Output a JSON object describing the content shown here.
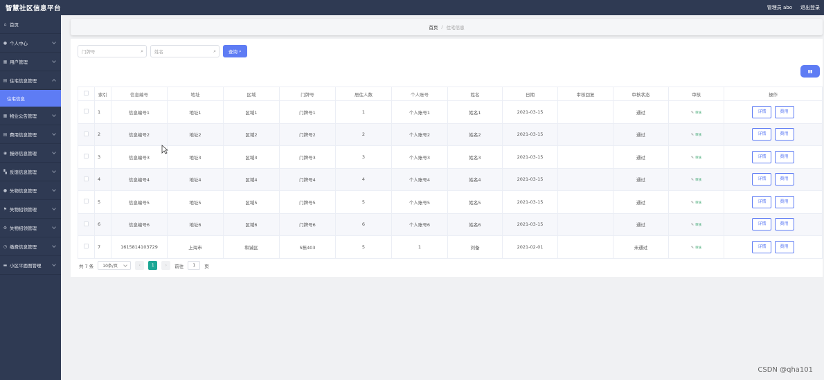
{
  "app": {
    "title": "智慧社区信息平台",
    "admin": "管理员 abo",
    "logout": "退出登录"
  },
  "sidebar": {
    "home": "首页",
    "personal": "个人中心",
    "users": "用户管理",
    "housing": "住宅信息管理",
    "housing_sub": "住宅信息",
    "items": [
      {
        "label": "物业公告管理",
        "icon": "grid-icon"
      },
      {
        "label": "費用信息管理",
        "icon": "doc-icon"
      },
      {
        "label": "报修信息管理",
        "icon": "circle-icon"
      },
      {
        "label": "反馈信息管理",
        "icon": "apps-icon"
      },
      {
        "label": "失物信息管理",
        "icon": "user-icon"
      },
      {
        "label": "失物招领管理",
        "icon": "flag-icon"
      },
      {
        "label": "失物招领管理",
        "icon": "gear-icon"
      },
      {
        "label": "缴费信息管理",
        "icon": "clock-icon"
      },
      {
        "label": "小区平面图管理",
        "icon": "chat-icon"
      }
    ]
  },
  "breadcrumb": {
    "home": "首页",
    "sep": "/",
    "current": "住宅信息"
  },
  "search": {
    "door_placeholder": "门牌号",
    "name_placeholder": "姓名",
    "query_label": "查询"
  },
  "table": {
    "headers": [
      "索引",
      "信息编号",
      "地址",
      "区域",
      "门牌号",
      "居住人数",
      "个人账号",
      "姓名",
      "日期",
      "审核回复",
      "审核状态",
      "审核",
      "操作"
    ],
    "audit_label": "审核",
    "detail_label": "详情",
    "fee_label": "費用",
    "rows": [
      {
        "idx": "1",
        "code": "信息编号1",
        "addr": "地址1",
        "area": "区域1",
        "door": "门牌号1",
        "count": "1",
        "account": "个人账号1",
        "name": "姓名1",
        "date": "2021-03-15",
        "reply": "",
        "status": "通过"
      },
      {
        "idx": "2",
        "code": "信息编号2",
        "addr": "地址2",
        "area": "区域2",
        "door": "门牌号2",
        "count": "2",
        "account": "个人账号2",
        "name": "姓名2",
        "date": "2021-03-15",
        "reply": "",
        "status": "通过"
      },
      {
        "idx": "3",
        "code": "信息编号3",
        "addr": "地址3",
        "area": "区域3",
        "door": "门牌号3",
        "count": "3",
        "account": "个人账号3",
        "name": "姓名3",
        "date": "2021-03-15",
        "reply": "",
        "status": "通过"
      },
      {
        "idx": "4",
        "code": "信息编号4",
        "addr": "地址4",
        "area": "区域4",
        "door": "门牌号4",
        "count": "4",
        "account": "个人账号4",
        "name": "姓名4",
        "date": "2021-03-15",
        "reply": "",
        "status": "通过"
      },
      {
        "idx": "5",
        "code": "信息编号5",
        "addr": "地址5",
        "area": "区域5",
        "door": "门牌号5",
        "count": "5",
        "account": "个人账号5",
        "name": "姓名5",
        "date": "2021-03-15",
        "reply": "",
        "status": "通过"
      },
      {
        "idx": "6",
        "code": "信息编号6",
        "addr": "地址6",
        "area": "区域6",
        "door": "门牌号6",
        "count": "6",
        "account": "个人账号6",
        "name": "姓名6",
        "date": "2021-03-15",
        "reply": "",
        "status": "通过"
      },
      {
        "idx": "7",
        "code": "1615814103729",
        "addr": "上海市",
        "area": "和诚区",
        "door": "5栋403",
        "count": "5",
        "account": "1",
        "name": "刘备",
        "date": "2021-02-01",
        "reply": "",
        "status": "未通过"
      }
    ]
  },
  "pagination": {
    "total": "共 7 条",
    "page_size": "10条/页",
    "prev": "‹",
    "current_page": "1",
    "next": "›",
    "goto_label": "前往",
    "goto_value": "1",
    "page_unit": "页"
  },
  "watermark": "CSDN @qha101",
  "colors": {
    "accent": "#5e7cf4",
    "sidebar": "#2f3a53",
    "page_active": "#1ca795",
    "audit": "#3aa56e"
  }
}
